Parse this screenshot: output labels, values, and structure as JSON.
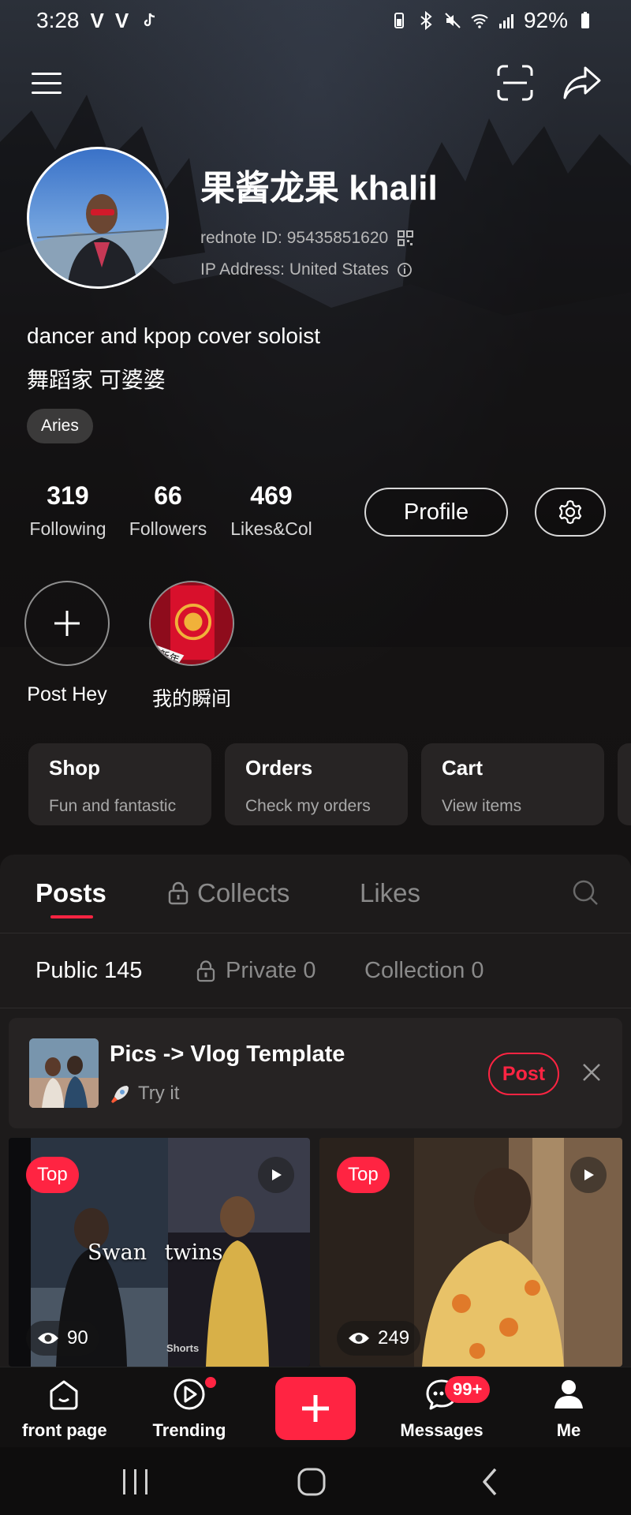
{
  "status_bar": {
    "time": "3:28",
    "notifications": [
      "V",
      "V"
    ],
    "battery": "92%"
  },
  "profile": {
    "username": "果酱龙果 khalil",
    "rednote_id": "rednote ID: 95435851620",
    "ip_address": "IP Address: United States",
    "bio_line1": "dancer and kpop cover soloist",
    "bio_line2": "舞蹈家 可婆婆",
    "tag": "Aries",
    "stats": [
      {
        "value": "319",
        "label": "Following"
      },
      {
        "value": "66",
        "label": "Followers"
      },
      {
        "value": "469",
        "label": "Likes&Col"
      }
    ],
    "profile_button": "Profile"
  },
  "stories": [
    {
      "label": "Post Hey"
    },
    {
      "label": "我的瞬间",
      "image_text": "新年"
    }
  ],
  "cards": [
    {
      "title": "Shop",
      "subtitle": "Fun and fantastic"
    },
    {
      "title": "Orders",
      "subtitle": "Check my orders"
    },
    {
      "title": "Cart",
      "subtitle": "View items"
    }
  ],
  "tabs": [
    {
      "label": "Posts"
    },
    {
      "label": "Collects"
    },
    {
      "label": "Likes"
    }
  ],
  "subtabs": [
    {
      "label": "Public 145"
    },
    {
      "label": "Private 0"
    },
    {
      "label": "Collection 0"
    }
  ],
  "promo": {
    "title": "Pics -> Vlog Template",
    "subtitle": "Try it",
    "button": "Post"
  },
  "posts": [
    {
      "badge": "Top",
      "caption": "Swan twins",
      "views": "90",
      "watermark": "Shorts"
    },
    {
      "badge": "Top",
      "views": "249"
    }
  ],
  "bottom_nav": {
    "items": [
      {
        "label": "front page"
      },
      {
        "label": "Trending"
      },
      {
        "label": "Messages"
      },
      {
        "label": "Me"
      }
    ],
    "messages_badge": "99+"
  },
  "colors": {
    "accent": "#ff2442",
    "background": "#141212",
    "panel": "#1d1b1b"
  }
}
